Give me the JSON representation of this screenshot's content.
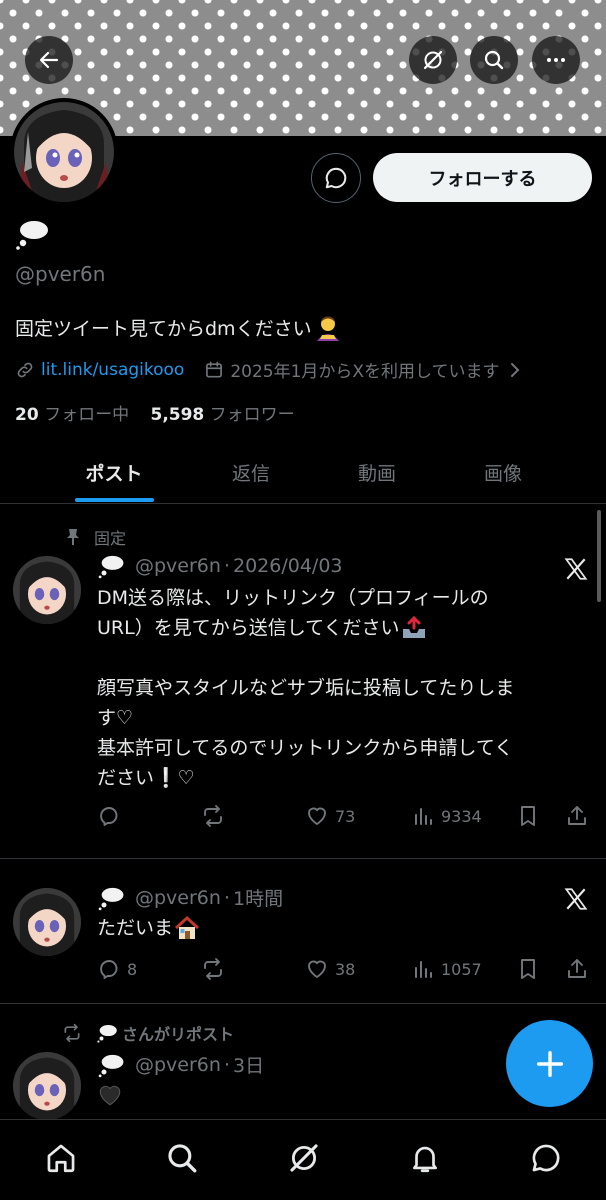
{
  "header": {
    "back": "back-arrow-icon",
    "grok": "grok-icon",
    "search": "search-icon",
    "more": "more-icon"
  },
  "profile": {
    "display_name_emoji": "thought-bubble",
    "handle": "@pver6n",
    "bio": "固定ツイート見てからdmください",
    "bio_emoji": "person-bowing",
    "link": "lit.link/usagikooo",
    "joined": "2025年1月からXを利用しています",
    "following_count": "20",
    "following_label": "フォロー中",
    "followers_count": "5,598",
    "followers_label": "フォロワー",
    "follow_button": "フォローする"
  },
  "tabs": [
    {
      "label": "ポスト",
      "active": true
    },
    {
      "label": "返信"
    },
    {
      "label": "動画"
    },
    {
      "label": "画像"
    }
  ],
  "tweets": [
    {
      "context": "固定",
      "handle": "@pver6n",
      "dot": "·",
      "time": "2026/04/03",
      "lines": [
        "DM送る際は、リットリンク（プロフィールの",
        "URL）を見てから送信してください",
        "",
        "顔写真やスタイルなどサブ垢に投稿してたりしま",
        "す♡",
        "基本許可してるのでリットリンクから申請してく",
        "ださい❕♡"
      ],
      "replies": "",
      "reposts": "",
      "likes": "73",
      "views": "9334"
    },
    {
      "handle": "@pver6n",
      "dot": "·",
      "time": "1時間",
      "text": "ただいま",
      "replies": "8",
      "reposts": "",
      "likes": "38",
      "views": "1057"
    },
    {
      "context": "さんがリポスト",
      "handle": "@pver6n",
      "dot": "·",
      "time": "3日",
      "text": "🖤"
    }
  ],
  "colors": {
    "accent": "#1d9bf0",
    "muted": "#71767b",
    "text": "#e7e9ea",
    "border": "#2f3336"
  }
}
